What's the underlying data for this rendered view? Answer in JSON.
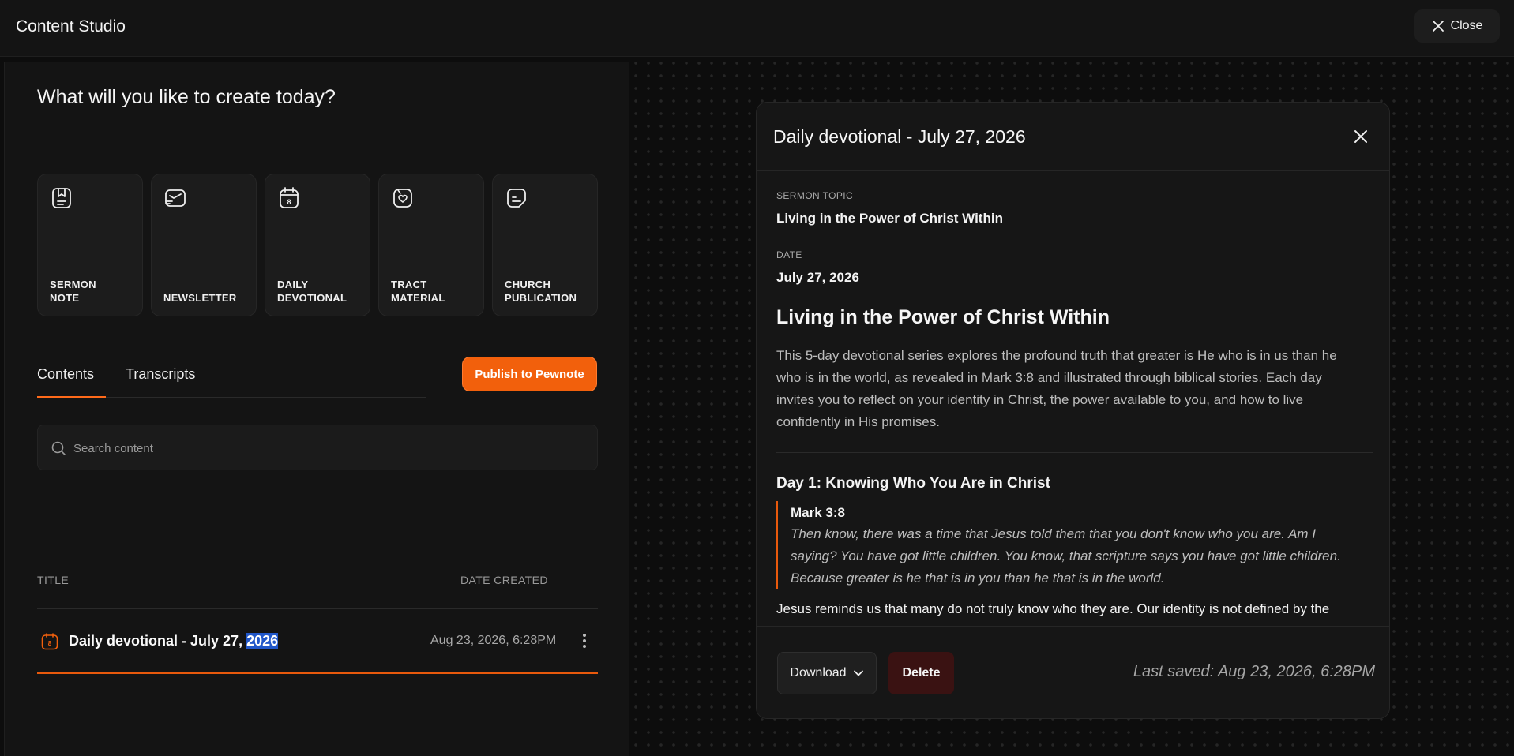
{
  "app": {
    "title": "Content Studio",
    "close_label": "Close"
  },
  "left": {
    "heading": "What will you like to create today?",
    "cards": [
      {
        "line1": "SERMON",
        "line2": "NOTE",
        "icon": "bookmark-doc-icon"
      },
      {
        "line1": "NEWSLETTER",
        "line2": "",
        "icon": "newsletter-icon"
      },
      {
        "line1": "DAILY",
        "line2": "DEVOTIONAL",
        "icon": "calendar-icon"
      },
      {
        "line1": "TRACT",
        "line2": "MATERIAL",
        "icon": "heart-tract-icon"
      },
      {
        "line1": "CHURCH",
        "line2": "PUBLICATION",
        "icon": "publication-icon"
      }
    ],
    "tabs": {
      "contents": "Contents",
      "transcripts": "Transcripts"
    },
    "publish_label": "Publish to Pewnote",
    "search_placeholder": "Search content",
    "table": {
      "col_title": "TITLE",
      "col_date": "DATE CREATED",
      "row": {
        "title_prefix": "Daily devotional - July 27, ",
        "title_selected": "2026",
        "date": "Aug 23, 2026, 6:28PM"
      }
    }
  },
  "modal": {
    "title": "Daily devotional - July 27, 2026",
    "topic_label": "SERMON TOPIC",
    "topic": "Living in the Power of Christ Within",
    "date_label": "DATE",
    "date": "July 27, 2026",
    "heading": "Living in the Power of Christ Within",
    "description": "This 5-day devotional series explores the profound truth that greater is He who is in us than he who is in the world, as revealed in Mark 3:8 and illustrated through biblical stories. Each day invites you to reflect on your identity in Christ, the power available to you, and how to live confidently in His promises.",
    "day1_title": "Day 1: Knowing Who You Are in Christ",
    "quote_ref": "Mark 3:8",
    "quote_text": "Then know, there was a time that Jesus told them that you don't know who you are. Am I saying? You have got little children. You know, that scripture says you have got little children. Because greater is he that is in you than he that is in the world.",
    "paragraph": "Jesus reminds us that many do not truly know who they are. Our identity is not defined by the world but by the presence of God within us. The above phrase took. He that is Love, the sign that",
    "download_label": "Download",
    "delete_label": "Delete",
    "last_saved": "Last saved: Aug 23, 2026, 6:28PM"
  },
  "colors": {
    "accent": "#f2600c",
    "background": "#0d0d0d",
    "panel": "#141414",
    "danger": "#3a1212",
    "selection": "#2157c9"
  }
}
